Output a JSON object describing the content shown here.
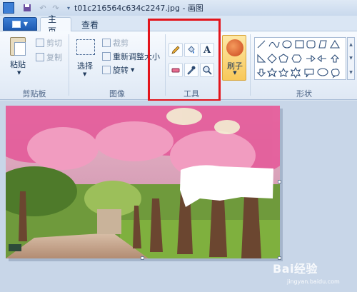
{
  "window": {
    "title": "t01c216564c634c2247.jpg - 画图"
  },
  "tabs": {
    "home": "主页",
    "view": "查看"
  },
  "clipboard": {
    "paste": "粘贴",
    "cut": "剪切",
    "copy": "复制",
    "group_label": "剪贴板"
  },
  "image": {
    "select": "选择",
    "crop": "裁剪",
    "resize": "重新调整大小",
    "rotate": "旋转",
    "group_label": "图像"
  },
  "tools": {
    "group_label": "工具",
    "text_glyph": "A"
  },
  "brushes": {
    "label": "刷子"
  },
  "shapes": {
    "group_label": "形状"
  },
  "watermark": {
    "main": "Bai经验",
    "sub": "jingyan.baidu.com"
  },
  "colors": {
    "accent": "#1d5bb2",
    "highlight_box": "#e3141b",
    "ribbon_bg": "#f7fafe"
  }
}
